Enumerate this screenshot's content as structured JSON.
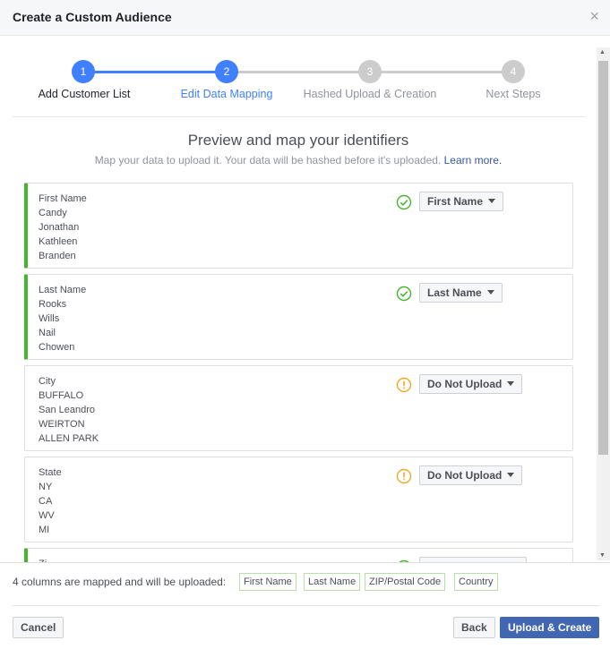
{
  "dialog": {
    "title": "Create a Custom Audience",
    "close_label": "×"
  },
  "stepper": {
    "steps": [
      {
        "num": "1",
        "label": "Add Customer List",
        "state": "done"
      },
      {
        "num": "2",
        "label": "Edit Data Mapping",
        "state": "active"
      },
      {
        "num": "3",
        "label": "Hashed Upload & Creation",
        "state": "pending"
      },
      {
        "num": "4",
        "label": "Next Steps",
        "state": "pending"
      }
    ]
  },
  "main": {
    "title": "Preview and map your identifiers",
    "subtitle": "Map your data to upload it. Your data will be hashed before it's uploaded.",
    "learn_more": "Learn more."
  },
  "columns": [
    {
      "header": "First Name",
      "values": [
        "Candy",
        "Jonathan",
        "Kathleen",
        "Branden"
      ],
      "status": "mapped",
      "mapping": "First Name"
    },
    {
      "header": "Last Name",
      "values": [
        "Rooks",
        "Wills",
        "Nail",
        "Chowen"
      ],
      "status": "mapped",
      "mapping": "Last Name"
    },
    {
      "header": "City",
      "values": [
        "BUFFALO",
        "San Leandro",
        "WEIRTON",
        "ALLEN PARK"
      ],
      "status": "warning",
      "mapping": "Do Not Upload"
    },
    {
      "header": "State",
      "values": [
        "NY",
        "CA",
        "WV",
        "MI"
      ],
      "status": "warning",
      "mapping": "Do Not Upload"
    },
    {
      "header": "Zi",
      "values": [],
      "status": "mapped",
      "mapping": ""
    }
  ],
  "footer": {
    "summary": "4 columns are mapped and will be uploaded:",
    "chips": [
      "First Name",
      "Last Name",
      "ZIP/Postal Code",
      "Country"
    ],
    "cancel": "Cancel",
    "back": "Back",
    "upload": "Upload & Create"
  },
  "colors": {
    "accent_blue": "#4080ff",
    "primary_button": "#4267b2",
    "mapped_green": "#42b72a",
    "warning_orange": "#f5a623",
    "inactive_grey": "#cccccc"
  }
}
